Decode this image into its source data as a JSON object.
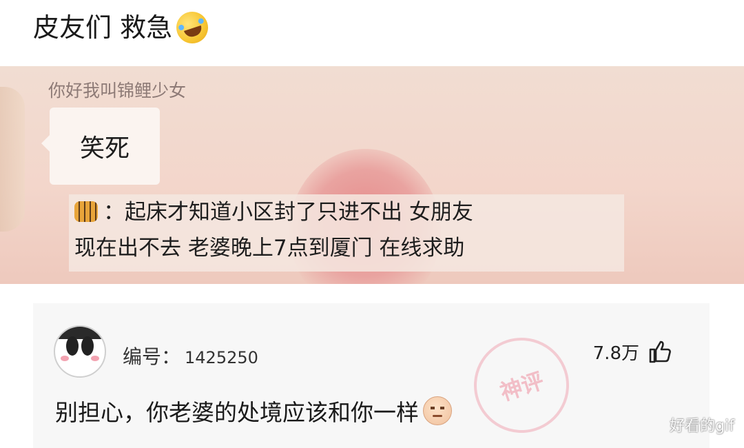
{
  "post": {
    "title": "皮友们 救急",
    "title_emoji": "rolling-laughing-emoji"
  },
  "screenshot": {
    "sender_name": "你好我叫锦鲤少女",
    "bubble_text": "笑死",
    "caption_line1": "：起床才知道小区封了只进不出 女朋友",
    "caption_line2": "现在出不去 老婆晚上7点到厦门 在线求助",
    "caption_icon": "tiger-icon"
  },
  "comment": {
    "user_label": "编号：",
    "user_number": "1425250",
    "like_count": "7.8万",
    "text": "别担心，你老婆的处境应该和你一样",
    "stamp_text": "神评"
  },
  "watermark": "好看的gif",
  "colors": {
    "chat_bg": "#f1ddd2",
    "comment_bg": "#f7f7f7",
    "stamp": "#ec788c"
  }
}
